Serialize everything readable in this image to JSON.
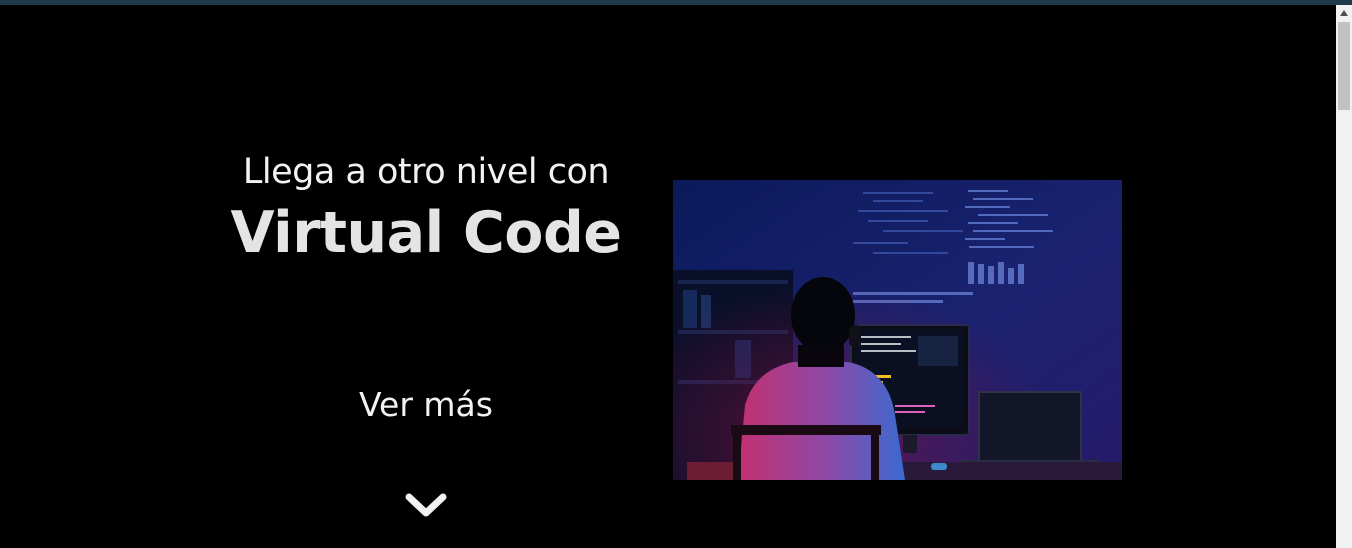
{
  "hero": {
    "subtitle": "Llega a otro nivel con",
    "title": "Virtual Code",
    "see_more_label": "Ver más"
  },
  "icons": {
    "chevron": "chevron-down-icon",
    "scroll_up": "scroll-up-arrow-icon"
  },
  "colors": {
    "background": "#000000",
    "text": "#f2f2f2",
    "title": "#e4e4e4",
    "top_bar": "#1e3a48",
    "image_tint": "#1b1a6e"
  }
}
